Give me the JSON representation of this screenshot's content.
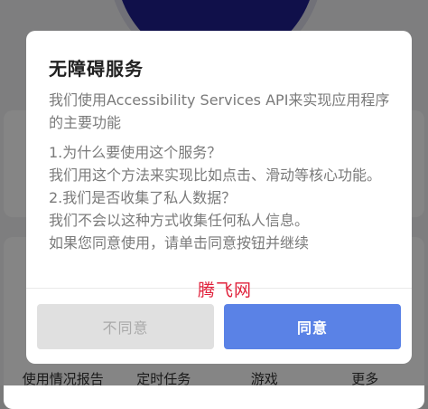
{
  "background": {
    "bottom_nav": [
      "使用情况报告",
      "定时任务",
      "游戏",
      "更多"
    ]
  },
  "dialog": {
    "title": "无障碍服务",
    "intro": "我们使用Accessibility Services API来实现应用程序的主要功能",
    "lines": [
      "1.为什么要使用这个服务？",
      "我们用这个方法来实现比如点击、滑动等核心功能。",
      "2.我们是否收集了私人数据？",
      "我们不会以这种方式收集任何私人信息。",
      "如果您同意使用，请单击同意按钮并继续"
    ],
    "watermark": "腾飞网",
    "buttons": {
      "disagree": "不同意",
      "agree": "同意"
    }
  },
  "colors": {
    "accent": "#5a82e6",
    "watermark": "#e0203a"
  }
}
